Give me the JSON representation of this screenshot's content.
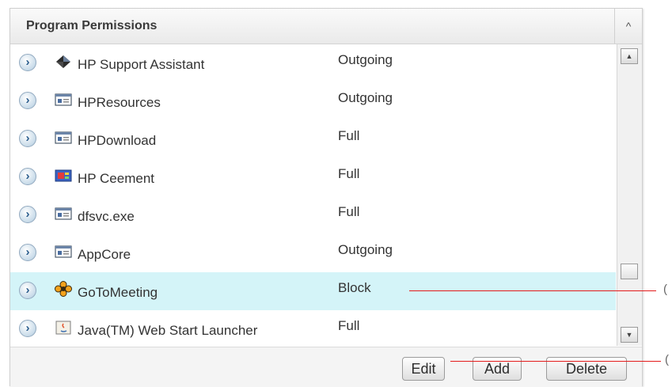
{
  "panel": {
    "title": "Program Permissions",
    "collapse_glyph": "^"
  },
  "rows": [
    {
      "name": "HP Support Assistant",
      "permission": "Outgoing",
      "icon": "hp-support-icon",
      "selected": false
    },
    {
      "name": "HPResources",
      "permission": "Outgoing",
      "icon": "window-app-icon",
      "selected": false
    },
    {
      "name": "HPDownload",
      "permission": "Full",
      "icon": "window-app-icon",
      "selected": false
    },
    {
      "name": "HP Ceement",
      "permission": "Full",
      "icon": "colored-app-icon",
      "selected": false
    },
    {
      "name": "dfsvc.exe",
      "permission": "Full",
      "icon": "window-app-icon",
      "selected": false
    },
    {
      "name": "AppCore",
      "permission": "Outgoing",
      "icon": "window-app-icon",
      "selected": false
    },
    {
      "name": "GoToMeeting",
      "permission": "Block",
      "icon": "gotomeeting-flower-icon",
      "selected": true
    },
    {
      "name": "Java(TM) Web Start Launcher",
      "permission": "Full",
      "icon": "java-icon",
      "selected": false
    }
  ],
  "expand_glyph": "›",
  "scrollbar": {
    "up_glyph": "▲",
    "down_glyph": "▼"
  },
  "buttons": {
    "edit": "Edit",
    "add": "Add",
    "delete": "Delete"
  },
  "callouts": {
    "marker": "("
  },
  "colors": {
    "selected_row": "#d4f4f8",
    "callout_line": "#e31b1b"
  }
}
